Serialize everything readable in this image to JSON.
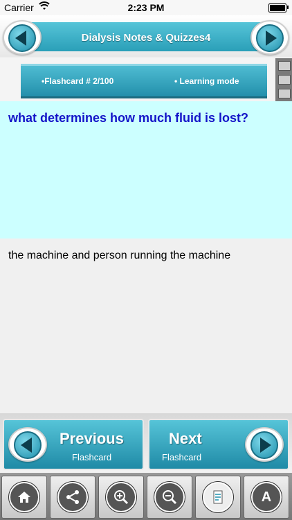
{
  "status_bar": {
    "carrier": "Carrier",
    "time": "2:23 PM"
  },
  "header": {
    "title": "Dialysis Notes & Quizzes4"
  },
  "info": {
    "flashcard_label": "•Flashcard #  2/100",
    "mode_label": "• Learning mode"
  },
  "card": {
    "question": "what determines how much fluid is lost?",
    "answer": "the machine and person running the machine"
  },
  "nav": {
    "previous_title": "Previous",
    "previous_sub": "Flashcard",
    "next_title": "Next",
    "next_sub": "Flashcard"
  },
  "toolbar": {
    "icons": [
      "home-icon",
      "share-icon",
      "zoom-in-icon",
      "zoom-out-icon",
      "notes-icon",
      "font-icon"
    ]
  },
  "colors": {
    "accent": "#2a9fb8",
    "question_bg": "#ccffff",
    "question_text": "#1313c8"
  }
}
